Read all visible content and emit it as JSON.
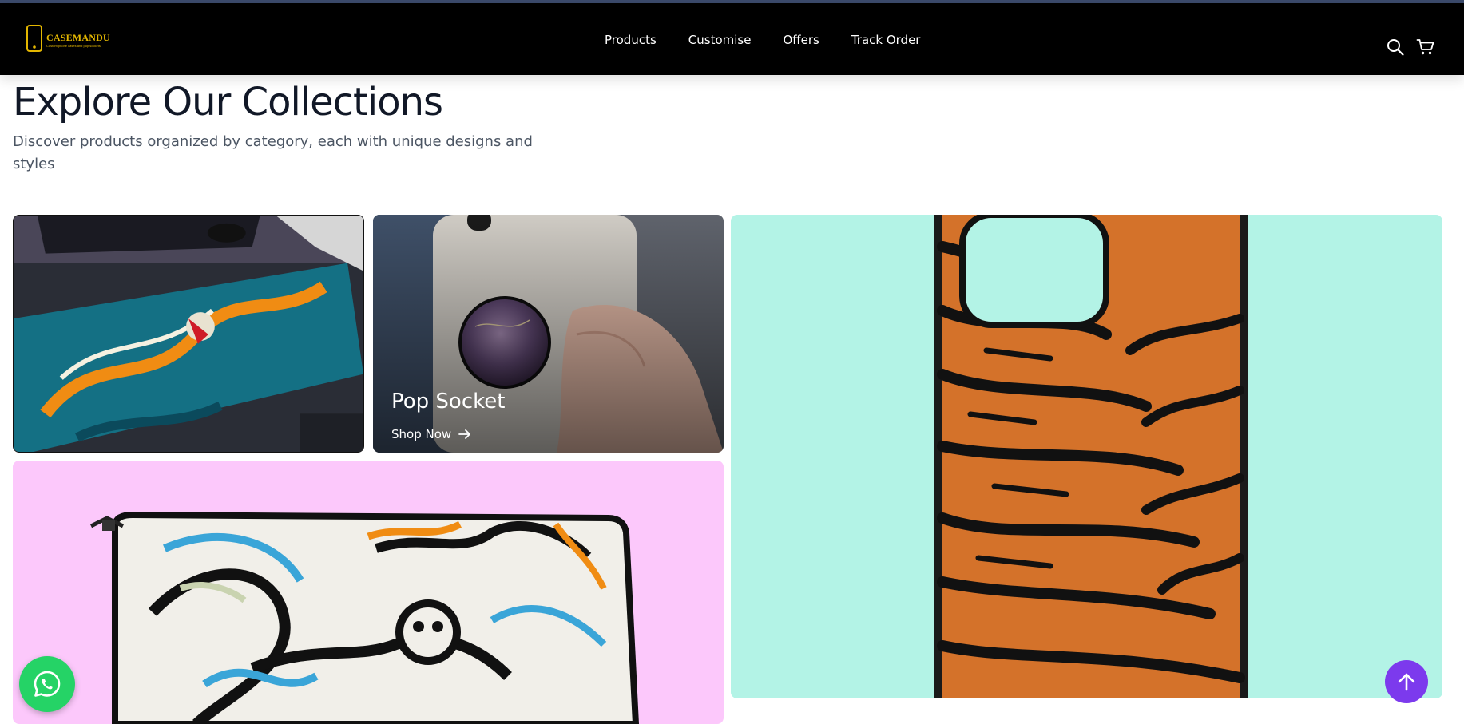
{
  "brand": {
    "name": "CASEMANDU",
    "tagline": "Custom phone cases and pop sockets",
    "accent_color": "#e3b600",
    "logo_icon": "phone-icon"
  },
  "nav": {
    "links": [
      "Products",
      "Customise",
      "Offers",
      "Track Order"
    ],
    "icons": [
      "search-icon",
      "cart-icon"
    ]
  },
  "hero": {
    "title": "Explore Our Collections",
    "subtitle": "Discover products organized by category, each with unique designs and styles"
  },
  "collections": [
    {
      "id": "mousepad",
      "image": "dragon-mousepad-image"
    },
    {
      "id": "pop-socket",
      "title": "Pop Socket",
      "cta": "Shop Now",
      "image": "pop-socket-image"
    },
    {
      "id": "laptop-sleeve",
      "image": "laptop-sleeve-image",
      "background": "#fcc8fb"
    },
    {
      "id": "phone-case",
      "image": "tiger-phone-case-image",
      "background": "#b3f3e6"
    }
  ],
  "floating": {
    "whatsapp_color": "#25d366",
    "scroll_top_color": "#7c3aed"
  }
}
